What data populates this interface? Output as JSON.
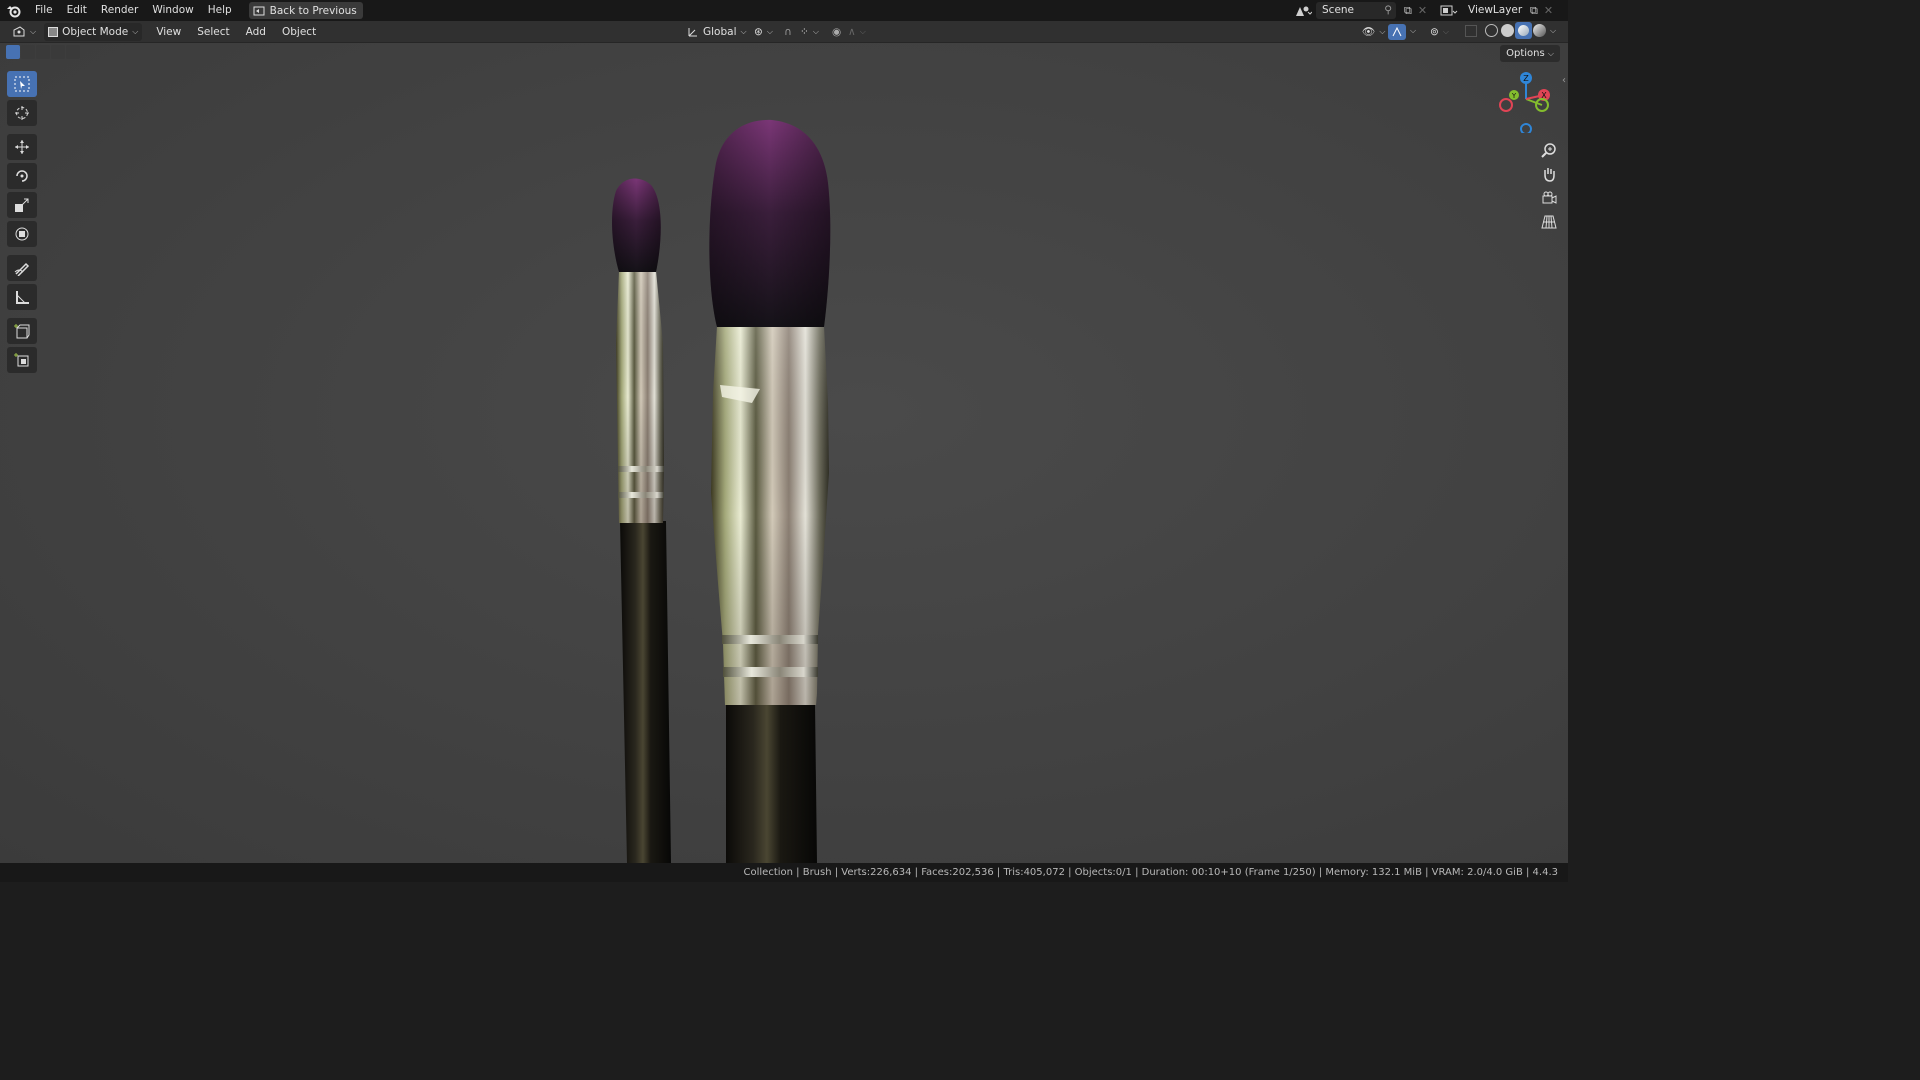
{
  "menubar": {
    "items": [
      "File",
      "Edit",
      "Render",
      "Window",
      "Help"
    ],
    "back_label": "Back to Previous",
    "scene_name": "Scene",
    "view_layer": "ViewLayer"
  },
  "header": {
    "mode": "Object Mode",
    "menus": [
      "View",
      "Select",
      "Add",
      "Object"
    ],
    "orientation": "Global",
    "options_label": "Options"
  },
  "toolbar": {
    "tools": [
      "select-box",
      "cursor",
      "move",
      "rotate",
      "scale",
      "transform",
      "annotate",
      "measure",
      "add-cube",
      "add-primitive"
    ]
  },
  "gizmo": {
    "axes": [
      "X",
      "Y",
      "Z"
    ],
    "colors": {
      "x": "#e04455",
      "y": "#84bd2e",
      "z": "#2f86d8"
    }
  },
  "statusbar": {
    "text": "Collection | Brush | Verts:226,634 | Faces:202,536 | Tris:405,072 | Objects:0/1 | Duration: 00:10+10 (Frame 1/250) | Memory: 132.1 MiB | VRAM: 2.0/4.0 GiB | 4.4.3"
  },
  "colors": {
    "accent": "#4772b3",
    "bristle_tip": "#6f2f6e",
    "bristle_base": "#151218"
  }
}
